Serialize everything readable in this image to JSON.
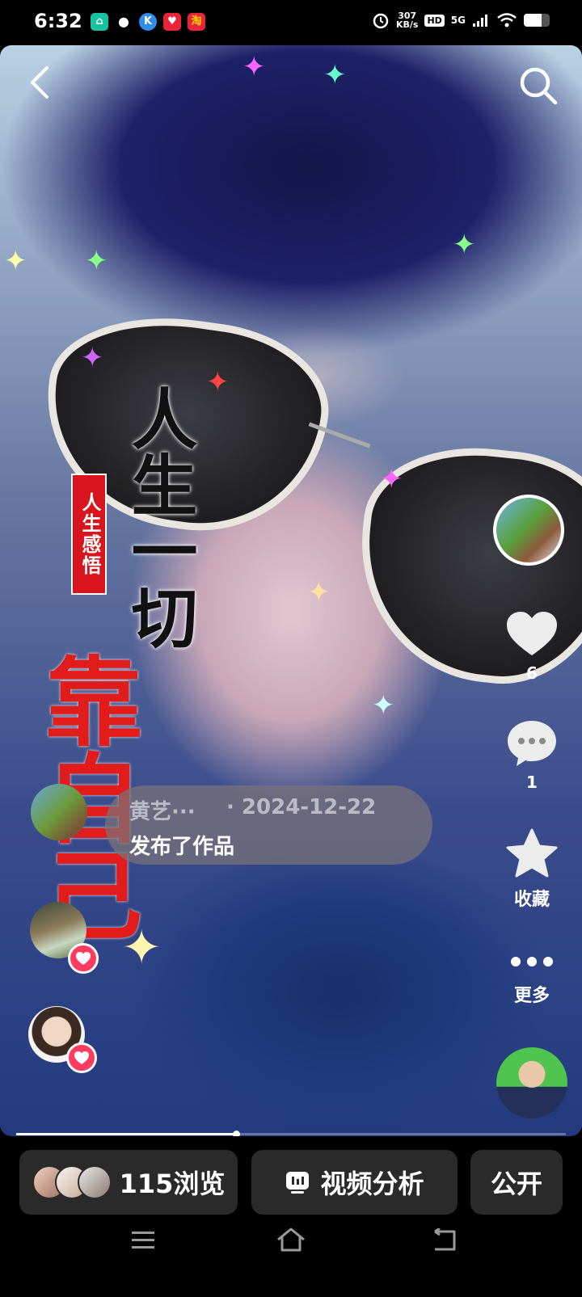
{
  "status": {
    "time": "6:32",
    "net_speed": "307",
    "net_unit": "KB/s",
    "hd": "HD",
    "network": "5G",
    "battery_level": 0.7,
    "apps": [
      {
        "icon": "home-app-icon",
        "color": "#17c2a0"
      },
      {
        "icon": "wechat-icon",
        "color": "#ffffff"
      },
      {
        "icon": "k-app-icon",
        "color": "#2f8fe8"
      },
      {
        "icon": "heart-app-icon",
        "color": "#e8233c"
      },
      {
        "icon": "taobao-app-icon",
        "color": "#e8233c"
      }
    ]
  },
  "overlay": {
    "seal_text": "人生感悟",
    "callig_black": "人生一切",
    "callig_red": "靠自己"
  },
  "publish": {
    "name": "黄艺···",
    "date": "· 2024-12-22",
    "action": "发布了作品"
  },
  "actions": {
    "like_count": "6",
    "comment_count": "1",
    "favorite_label": "收藏",
    "more_label": "更多"
  },
  "progress": 0.4,
  "bottom": {
    "views": "115浏览",
    "analysis": "视频分析",
    "public": "公开"
  },
  "colors": {
    "accent_pink": "#ff3c5f",
    "pill_bg": "#2a2a2a"
  }
}
